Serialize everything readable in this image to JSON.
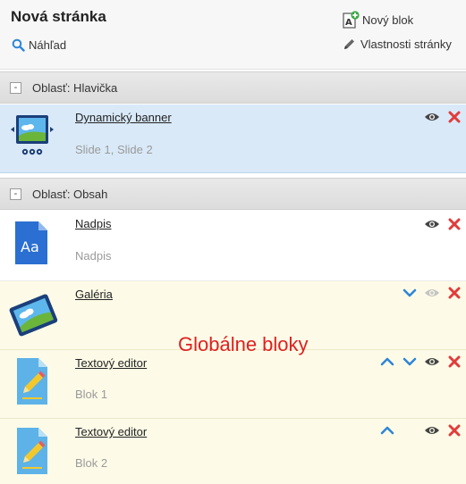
{
  "header": {
    "title": "Nová stránka",
    "preview_label": "Náhľad",
    "new_block_label": "Nový blok",
    "page_properties_label": "Vlastnosti stránky"
  },
  "areas": [
    {
      "label": "Oblasť: Hlavička",
      "collapse_symbol": "-",
      "blocks": [
        {
          "name": "Dynamický banner",
          "subtitle": "Slide 1, Slide 2",
          "icon": "banner-icon",
          "state": "selected"
        }
      ]
    },
    {
      "label": "Oblasť: Obsah",
      "collapse_symbol": "-",
      "blocks": [
        {
          "name": "Nadpis",
          "subtitle": "Nadpis",
          "icon": "heading-icon",
          "state": "normal"
        },
        {
          "name": "Galéria",
          "subtitle": "",
          "icon": "gallery-icon",
          "state": "global"
        },
        {
          "name": "Textový editor",
          "subtitle": "Blok 1",
          "icon": "text-editor-icon",
          "state": "global"
        },
        {
          "name": "Textový editor",
          "subtitle": "Blok 2",
          "icon": "text-editor-icon",
          "state": "global"
        }
      ]
    }
  ],
  "annotation": "Globálne bloky",
  "colors": {
    "accent_blue": "#2f86d6",
    "delete_red": "#e03c3c",
    "selected_bg": "#d9e9f8",
    "global_bg": "#fdfbe7",
    "annotation_red": "#e02020"
  }
}
